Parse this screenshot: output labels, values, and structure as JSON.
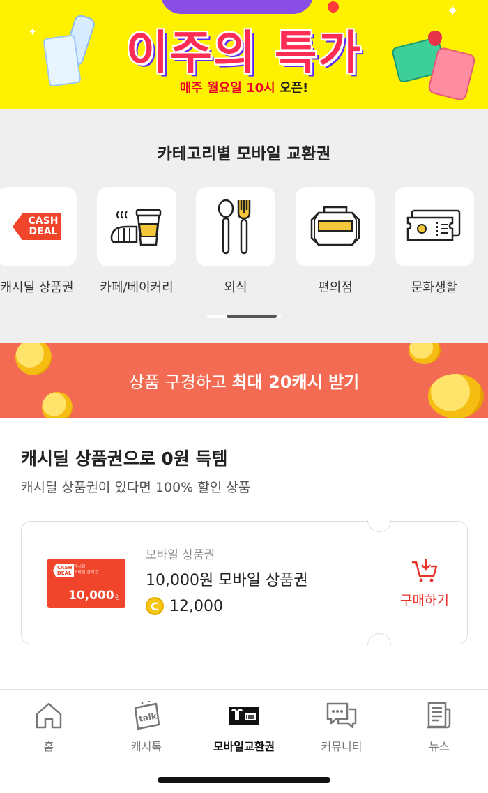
{
  "hero": {
    "title": "이주의 특가",
    "subtitle_highlight": "매주 월요일 10시",
    "subtitle_rest": " 오픈!"
  },
  "categories": {
    "title": "카테고리별 모바일 교환권",
    "items": [
      {
        "label": "캐시딜 상품권",
        "icon": "cashdeal-icon"
      },
      {
        "label": "카페/베이커리",
        "icon": "coffee-bread-icon"
      },
      {
        "label": "외식",
        "icon": "spoon-fork-icon"
      },
      {
        "label": "편의점",
        "icon": "store-jars-icon"
      },
      {
        "label": "문화생활",
        "icon": "ticket-icon"
      }
    ],
    "badge_line1": "CASH",
    "badge_line2": "DEAL"
  },
  "promo": {
    "text_normal": "상품 구경하고 ",
    "text_bold": "최대 20캐시 받기"
  },
  "section": {
    "title": "캐시딜 상품권으로 0원 득템",
    "subtitle": "캐시딜 상품권이 있다면 100% 할인 상품"
  },
  "coupon": {
    "voucher_logo_line1": "CASH",
    "voucher_logo_line2": "DEAL",
    "voucher_desc_line1": "캐시딜",
    "voucher_desc_line2": "모바일 금액권",
    "voucher_amount": "10,000",
    "voucher_unit": "원",
    "category": "모바일 상품권",
    "name": "10,000원 모바일 상품권",
    "coin_symbol": "C",
    "price": "12,000",
    "buy_label": "구매하기"
  },
  "nav": {
    "items": [
      {
        "label": "홈",
        "icon": "home-icon",
        "active": false
      },
      {
        "label": "캐시톡",
        "icon": "talk-icon",
        "active": false
      },
      {
        "label": "모바일교환권",
        "icon": "gift-card-icon",
        "active": true
      },
      {
        "label": "커뮤니티",
        "icon": "chat-icon",
        "active": false
      },
      {
        "label": "뉴스",
        "icon": "news-icon",
        "active": false
      }
    ],
    "talk_text": "talk"
  },
  "colors": {
    "hero_bg": "#fff200",
    "promo_bg": "#f26b52",
    "accent": "#e8322a"
  }
}
